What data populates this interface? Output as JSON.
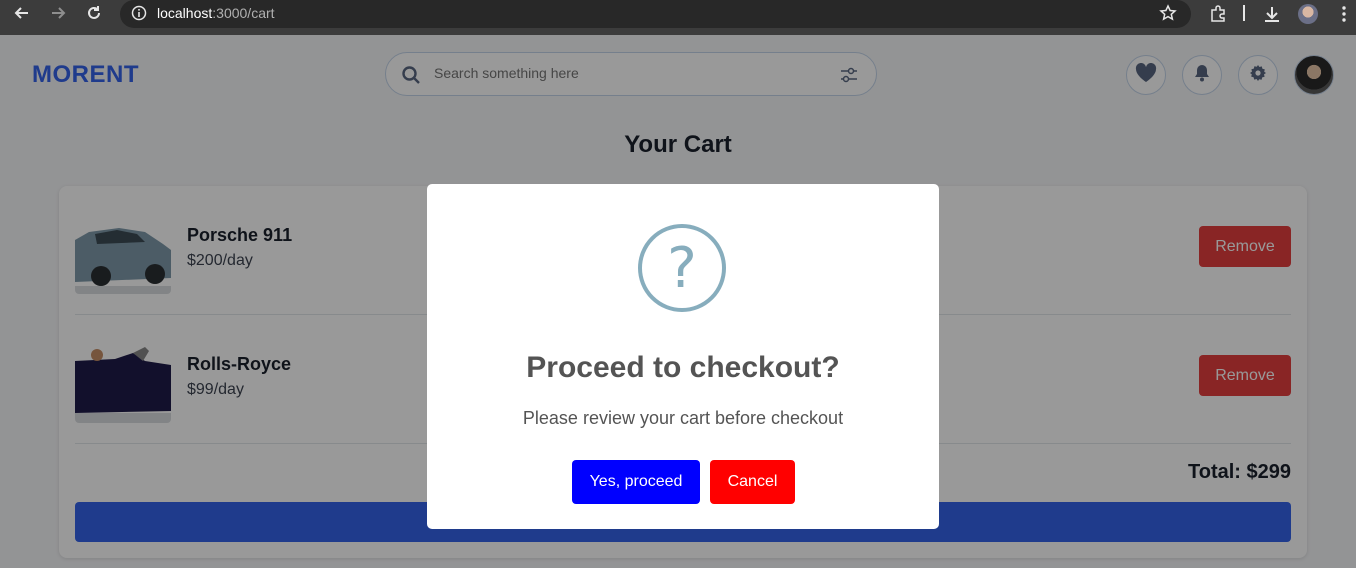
{
  "browser": {
    "url_host": "localhost",
    "url_rest": ":3000/cart"
  },
  "header": {
    "logo": "MORENT",
    "search_placeholder": "Search something here"
  },
  "page": {
    "title": "Your Cart"
  },
  "cart": {
    "items": [
      {
        "name": "Porsche 911",
        "price": "$200/day",
        "remove_label": "Remove"
      },
      {
        "name": "Rolls-Royce",
        "price": "$99/day",
        "remove_label": "Remove"
      }
    ],
    "total": "Total: $299"
  },
  "modal": {
    "icon": "?",
    "title": "Proceed to checkout?",
    "text": "Please review your cart before checkout",
    "confirm_label": "Yes, proceed",
    "cancel_label": "Cancel"
  },
  "colors": {
    "brand": "#3563e9",
    "remove": "#e53e3e",
    "confirm": "#0000ff",
    "cancel": "#ff0000"
  }
}
